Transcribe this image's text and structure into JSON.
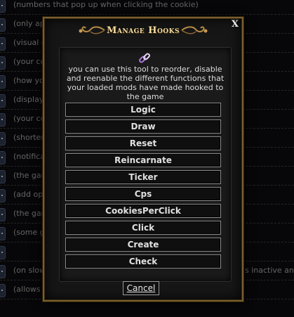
{
  "background_rows": [
    {
      "text": "(numbers that pop up when clicking the cookie)",
      "right": ""
    },
    {
      "text": "(only ap",
      "right": ""
    },
    {
      "text": "(visual d",
      "right": ""
    },
    {
      "text": "(your co",
      "right": ""
    },
    {
      "text": "(how yo",
      "right": ""
    },
    {
      "text": "(display",
      "right": ""
    },
    {
      "text": "(your co",
      "right": ""
    },
    {
      "text": "(shorten",
      "right": ""
    },
    {
      "text": "(notificat",
      "right": ""
    },
    {
      "text": "(the gam",
      "right": ""
    },
    {
      "text": "(add opt",
      "right": ""
    },
    {
      "text": "(the gam",
      "right": ""
    },
    {
      "text": "(some g",
      "right": ""
    },
    {
      "text": "",
      "right": ""
    },
    {
      "text": "(on slow",
      "right": "s inactive and"
    },
    {
      "text": "(allows c",
      "right": ""
    }
  ],
  "modal": {
    "title": "Manage Hooks",
    "close_label": "X",
    "description": "you can use this tool to reorder, disable and reenable the different functions that your loaded mods have made hooked to the game",
    "hooks": [
      "Logic",
      "Draw",
      "Reset",
      "Reincarnate",
      "Ticker",
      "Cps",
      "CookiesPerClick",
      "Click",
      "Create",
      "Check"
    ],
    "cancel_label": "Cancel",
    "icons": {
      "chain": "chain-link-icon",
      "ornament": "ornament-icon",
      "option": "option-button-icon"
    },
    "colors": {
      "title": "#f3dca0",
      "frame": "#7a5f2e",
      "chain": "#b07ad8"
    }
  }
}
